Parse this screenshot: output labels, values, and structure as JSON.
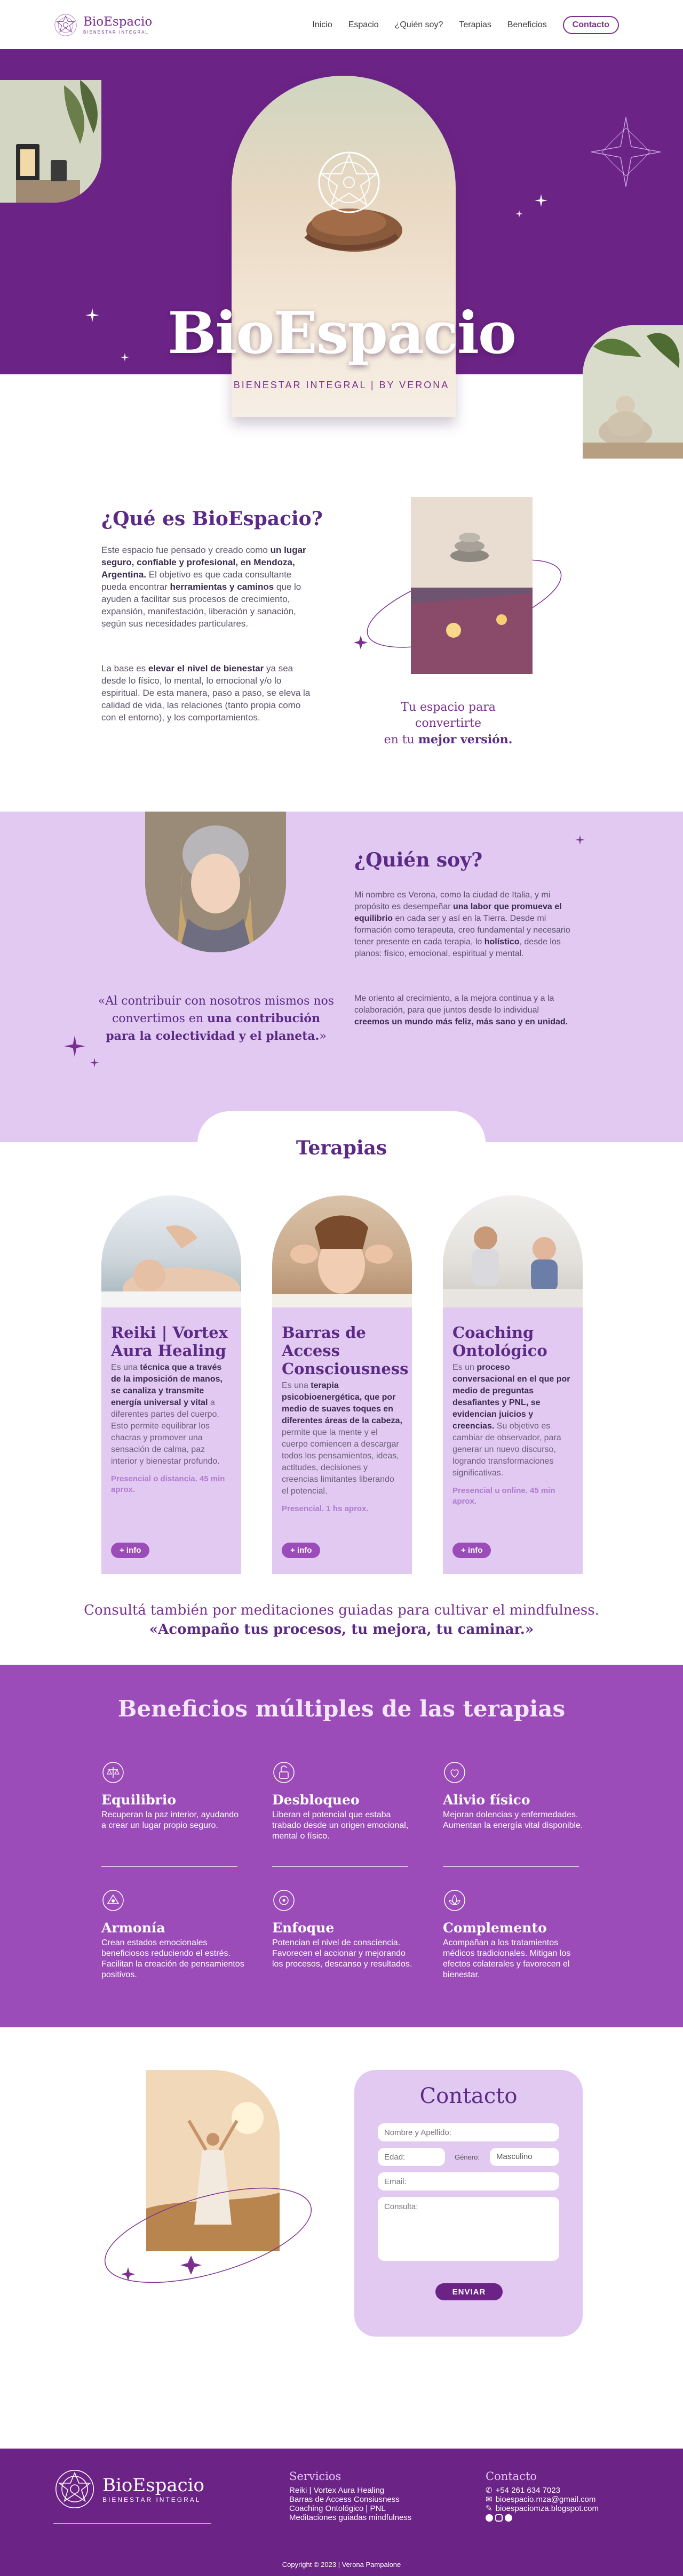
{
  "brand": {
    "name": "BioEspacio",
    "tagline": "BIENESTAR INTEGRAL",
    "accent": "#7b2f8f",
    "deep": "#6b2386",
    "lavender": "#e1c9f1",
    "orchid": "#9b4cb8"
  },
  "nav": {
    "items": [
      "Inicio",
      "Espacio",
      "¿Quién soy?",
      "Terapias",
      "Beneficios"
    ],
    "contact": "Contacto"
  },
  "hero": {
    "title": "BioEspacio",
    "subtitle": "BIENESTAR INTEGRAL | BY VERONA"
  },
  "que": {
    "title": "¿Qué es BioEspacio?",
    "p1_a": "Este espacio fue pensado y creado como ",
    "p1_b": "un lugar seguro, confiable y profesional, en Mendoza, Argentina.",
    "p1_c": " El objetivo es que cada consultante pueda encontrar ",
    "p1_d": "herramientas y caminos",
    "p1_e": " que lo ayuden a facilitar sus procesos de crecimiento, expansión, manifestación, liberación y sanación, según sus necesidades particulares.",
    "p2_a": "La base es ",
    "p2_b": "elevar el nivel de bienestar",
    "p2_c": " ya sea desde lo físico, lo mental, lo emocional y/o lo espiritual. De esta manera, paso a paso, se eleva la calidad de vida, las relaciones (tanto propia como con el entorno), y los comportamientos.",
    "tag_a": "Tu espacio para convertirte",
    "tag_b": "en tu ",
    "tag_c": "mejor versión."
  },
  "quien": {
    "title": "¿Quién soy?",
    "p1_a": "Mi nombre es Verona, como la ciudad de Italia, y mi propósito es desempeñar ",
    "p1_b": "una labor que promueva el equilibrio",
    "p1_c": " en cada ser y así en la Tierra. Desde mi formación como terapeuta, creo fundamental y necesario tener presente en cada terapia, lo ",
    "p1_d": "holístico",
    "p1_e": ", desde los planos: físico, emocional, espiritual y mental.",
    "p2_a": "Me oriento al crecimiento, a la mejora continua y a la colaboración, para que juntos desde lo individual ",
    "p2_b": "creemos un mundo más feliz, más sano y en unidad.",
    "quote_a": "«Al contribuir con nosotros mismos nos convertimos en ",
    "quote_b": "una contribución para la colectividad y el planeta.",
    "quote_c": "»"
  },
  "terapias": {
    "title": "Terapias",
    "cards": [
      {
        "title": "Reiki | Vortex Aura Healing",
        "d1": "Es una ",
        "d2": "técnica que a través de la imposición de manos, se canaliza y transmite energía universal y vital",
        "d3": " a diferentes partes del cuerpo. Esto permite equilibrar los chacras y promover una sensación de calma, paz interior y bienestar profundo.",
        "note": "Presencial o distancia. 45 min aprox.",
        "button": "+ info"
      },
      {
        "title": "Barras de Access Consciousness",
        "d1": "Es una ",
        "d2": "terapia psicobioenergética, que por medio de suaves toques en diferentes áreas de la cabeza,",
        "d3": " permite que la mente y el cuerpo comiencen a descargar todos los pensamientos, ideas, actitudes, decisiones y creencias limitantes liberando el potencial.",
        "note": "Presencial. 1 hs aprox.",
        "button": "+ info"
      },
      {
        "title": "Coaching Ontológico",
        "d1": "Es un ",
        "d2": "proceso conversacional en el que por medio de preguntas desafiantes y PNL, se evidencian juicios y creencias.",
        "d3": " Su objetivo es cambiar de observador, para generar un nuevo discurso, logrando transformaciones significativas.",
        "note": "Presencial u online. 45 min aprox.",
        "button": "+ info"
      }
    ],
    "footer_a": "Consultá también por meditaciones guiadas para cultivar el mindfulness.",
    "footer_b": "«Acompaño tus procesos, tu mejora, tu caminar.»"
  },
  "beneficios": {
    "title": "Beneficios múltiples de las terapias",
    "items": [
      {
        "icon": "balance-icon",
        "title": "Equilibrio",
        "text": "Recuperan la paz interior, ayudando a crear un lugar propio seguro."
      },
      {
        "icon": "unlock-icon",
        "title": "Desbloqueo",
        "text": "Liberan el potencial que estaba trabado desde un origen emocional, mental o físico."
      },
      {
        "icon": "relief-icon",
        "title": "Alivio físico",
        "text": "Mejoran dolencias y enfermedades. Aumentan la energía vital disponible."
      },
      {
        "icon": "harmony-icon",
        "title": "Armonía",
        "text": "Crean estados emocionales beneficiosos reduciendo el estrés. Facilitan la creación de pensamientos positivos."
      },
      {
        "icon": "focus-icon",
        "title": "Enfoque",
        "text": "Potencian el nivel de consciencia. Favorecen el accionar y mejorando los procesos, descanso y resultados."
      },
      {
        "icon": "lotus-icon",
        "title": "Complemento",
        "text": "Acompañan a los tratamientos médicos tradicionales. Mitigan los efectos colaterales y favorecen el bienestar."
      }
    ]
  },
  "contacto": {
    "title": "Contacto",
    "name_ph": "Nombre y Apellido:",
    "age_ph": "Edad:",
    "gender_label": "Género:",
    "gender_value": "Masculino",
    "email_ph": "Email:",
    "msg_ph": "Consulta:",
    "send": "ENVIAR"
  },
  "footer": {
    "name": "BioEspacio",
    "tagline": "BIENESTAR INTEGRAL",
    "services_title": "Servicios",
    "services": [
      "Reiki | Vortex Aura Healing",
      "Barras de Access Consiusness",
      "Coaching Ontológico | PNL",
      "Meditaciones guiadas mindfulness"
    ],
    "contact_title": "Contacto",
    "phone": "+54 261 634 7023",
    "email": "bioespacio.mza@gmail.com",
    "blog": "bioespaciomza.blogspot.com",
    "copyright": "Copyright © 2023 | Verona Pampalone"
  }
}
